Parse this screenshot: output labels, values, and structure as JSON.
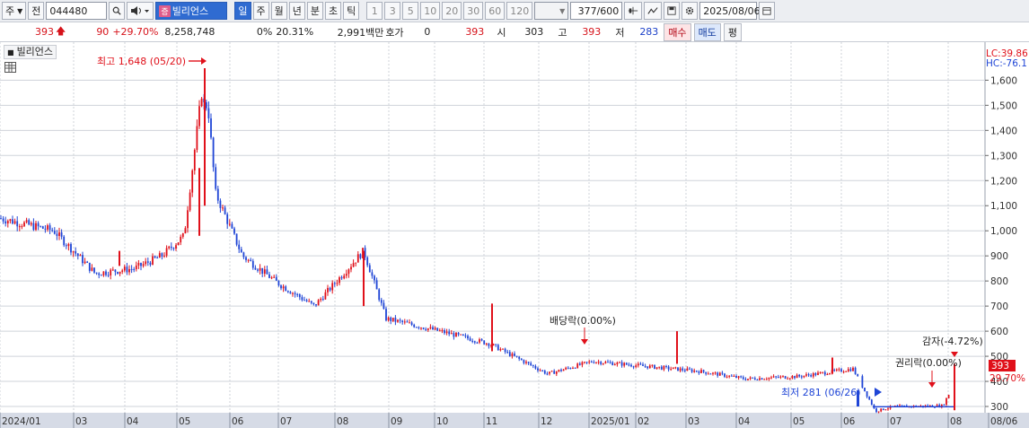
{
  "toolbar": {
    "market_label": "주",
    "prev_label": "전",
    "stock_code": "044480",
    "stock_badge": "증",
    "stock_name": "빌리언스",
    "periods": [
      "일",
      "주",
      "월",
      "년",
      "분",
      "초",
      "틱"
    ],
    "selected_period": "일",
    "intervals": [
      "1",
      "3",
      "5",
      "10",
      "20",
      "30",
      "60",
      "120"
    ],
    "count_display": "377",
    "count_max": "/600",
    "date": "2025/08/06"
  },
  "quote": {
    "price": "393",
    "change": "90",
    "change_pct": "+29.70%",
    "volume": "8,258,748",
    "vol_pct": "0%",
    "turnover_pct": "20.31%",
    "amount": "2,991백만",
    "hoga_label": "호가",
    "hoga_value": "0",
    "hoga_price": "393",
    "open_label": "시",
    "open": "303",
    "high_label": "고",
    "high": "393",
    "low_label": "저",
    "low": "283",
    "buy_label": "매수",
    "sell_label": "매도",
    "avg_label": "평"
  },
  "chart": {
    "legend_name": "빌리언스",
    "lc_label": "LC:39.86",
    "hc_label": "HC:-76.1",
    "max_annotation": "최고 1,648 (05/20)",
    "min_annotation": "최저 281 (06/26)",
    "dividend_annotation": "배당락(0.00%)",
    "rights_annotation": "권리락(0.00%)",
    "reduction_annotation": "감자(-4.72%)",
    "current_price_tag": "393",
    "current_pct_tag": "29.70%",
    "colors": {
      "up": "#e0101a",
      "down": "#1f45d6",
      "grid": "#cfd3da"
    }
  },
  "chart_data": {
    "type": "candlestick",
    "y_ticks": [
      300,
      400,
      500,
      600,
      700,
      800,
      900,
      1000,
      1100,
      1200,
      1300,
      1400,
      1500,
      1600
    ],
    "ylim": [
      250,
      1680
    ],
    "x_ticks": [
      "2024/01",
      "03",
      "04",
      "05",
      "06",
      "07",
      "08",
      "09",
      "10",
      "11",
      "12",
      "2025/01",
      "02",
      "03",
      "04",
      "05",
      "06",
      "07",
      "08",
      "08/06"
    ],
    "close_path": [
      [
        "2024/01",
        1050
      ],
      [
        "2024/02",
        1000
      ],
      [
        "2024/03",
        830
      ],
      [
        "2024/04",
        850
      ],
      [
        "2024/04-late",
        900
      ],
      [
        "2024/05",
        980
      ],
      [
        "2024/05/20",
        1648
      ],
      [
        "2024/05-end",
        1150
      ],
      [
        "2024/06",
        900
      ],
      [
        "2024/07",
        790
      ],
      [
        "2024/08",
        700
      ],
      [
        "2024/08-mid",
        920
      ],
      [
        "2024/09",
        650
      ],
      [
        "2024/10",
        600
      ],
      [
        "2024/11",
        550
      ],
      [
        "2024/12",
        430
      ],
      [
        "2025/01",
        480
      ],
      [
        "2025/02",
        460
      ],
      [
        "2025/03",
        440
      ],
      [
        "2025/04",
        410
      ],
      [
        "2025/05",
        420
      ],
      [
        "2025/06",
        450
      ],
      [
        "2025/06/26",
        281
      ],
      [
        "2025/07",
        300
      ],
      [
        "2025/08",
        303
      ],
      [
        "2025/08/06",
        393
      ]
    ]
  }
}
